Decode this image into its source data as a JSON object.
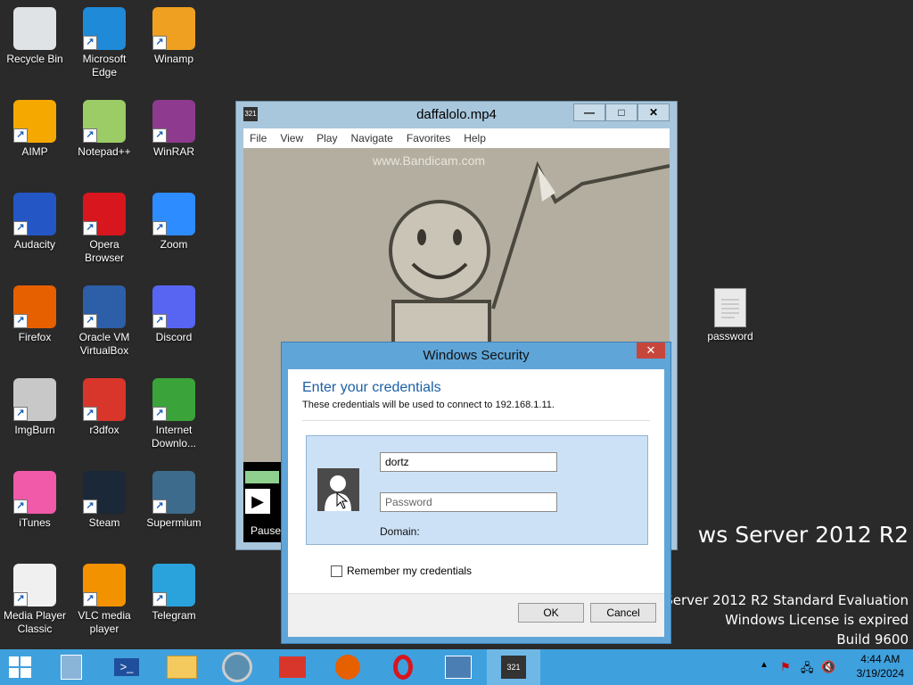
{
  "desktop_icons": [
    {
      "label": "Recycle Bin",
      "icon": "recycle-bin-icon",
      "color": "#dfe3e6"
    },
    {
      "label": "Microsoft Edge",
      "icon": "edge-icon",
      "color": "#1f8ad8"
    },
    {
      "label": "Winamp",
      "icon": "winamp-icon",
      "color": "#f0a020"
    },
    {
      "label": "AIMP",
      "icon": "aimp-icon",
      "color": "#f5a800"
    },
    {
      "label": "Notepad++",
      "icon": "notepadpp-icon",
      "color": "#9ccc65"
    },
    {
      "label": "WinRAR",
      "icon": "winrar-icon",
      "color": "#8e3a8e"
    },
    {
      "label": "Audacity",
      "icon": "audacity-icon",
      "color": "#2457c5"
    },
    {
      "label": "Opera Browser",
      "icon": "opera-icon",
      "color": "#d8161e"
    },
    {
      "label": "Zoom",
      "icon": "zoom-icon",
      "color": "#2d8cff"
    },
    {
      "label": "Firefox",
      "icon": "firefox-icon",
      "color": "#e66000"
    },
    {
      "label": "Oracle VM VirtualBox",
      "icon": "virtualbox-icon",
      "color": "#2d5ea8"
    },
    {
      "label": "Discord",
      "icon": "discord-icon",
      "color": "#5865f2"
    },
    {
      "label": "ImgBurn",
      "icon": "imgburn-icon",
      "color": "#c8c8c8"
    },
    {
      "label": "r3dfox",
      "icon": "r3dfox-icon",
      "color": "#d9362b"
    },
    {
      "label": "Internet Downlo...",
      "icon": "idm-icon",
      "color": "#3aa43a"
    },
    {
      "label": "iTunes",
      "icon": "itunes-icon",
      "color": "#f05aa8"
    },
    {
      "label": "Steam",
      "icon": "steam-icon",
      "color": "#1b2838"
    },
    {
      "label": "Supermium",
      "icon": "supermium-icon",
      "color": "#3d6b8c"
    },
    {
      "label": "Media Player Classic",
      "icon": "mpc-icon",
      "color": "#f0f0f0"
    },
    {
      "label": "VLC media player",
      "icon": "vlc-icon",
      "color": "#f39200"
    },
    {
      "label": "Telegram",
      "icon": "telegram-icon",
      "color": "#2aa3dd"
    }
  ],
  "desktop_file": {
    "label": "password",
    "icon": "text-file-icon"
  },
  "watermark": {
    "os": "ws Server 2012 R2",
    "edition": "ows Server 2012 R2 Standard Evaluation",
    "license": "Windows License is expired",
    "build": "Build 9600"
  },
  "player": {
    "title": "daffalolo.mp4",
    "menu": [
      "File",
      "View",
      "Play",
      "Navigate",
      "Favorites",
      "Help"
    ],
    "video_watermark": "www.Bandicam.com",
    "status": "Pause"
  },
  "dialog": {
    "title": "Windows Security",
    "close": "✕",
    "heading": "Enter your credentials",
    "subtitle": "These credentials will be used to connect to 192.168.1.11.",
    "username": "dortz",
    "password_placeholder": "Password",
    "domain_label": "Domain:",
    "remember_label": "Remember my credentials",
    "ok": "OK",
    "cancel": "Cancel"
  },
  "taskbar": {
    "items": [
      "start-icon",
      "server-manager-icon",
      "powershell-icon",
      "file-explorer-icon",
      "supermium-icon",
      "r3dfox-icon",
      "firefox-icon",
      "opera-icon",
      "network-icon",
      "mpc-icon"
    ],
    "time": "4:44 AM",
    "date": "3/19/2024",
    "accent": "#3fa0de"
  }
}
